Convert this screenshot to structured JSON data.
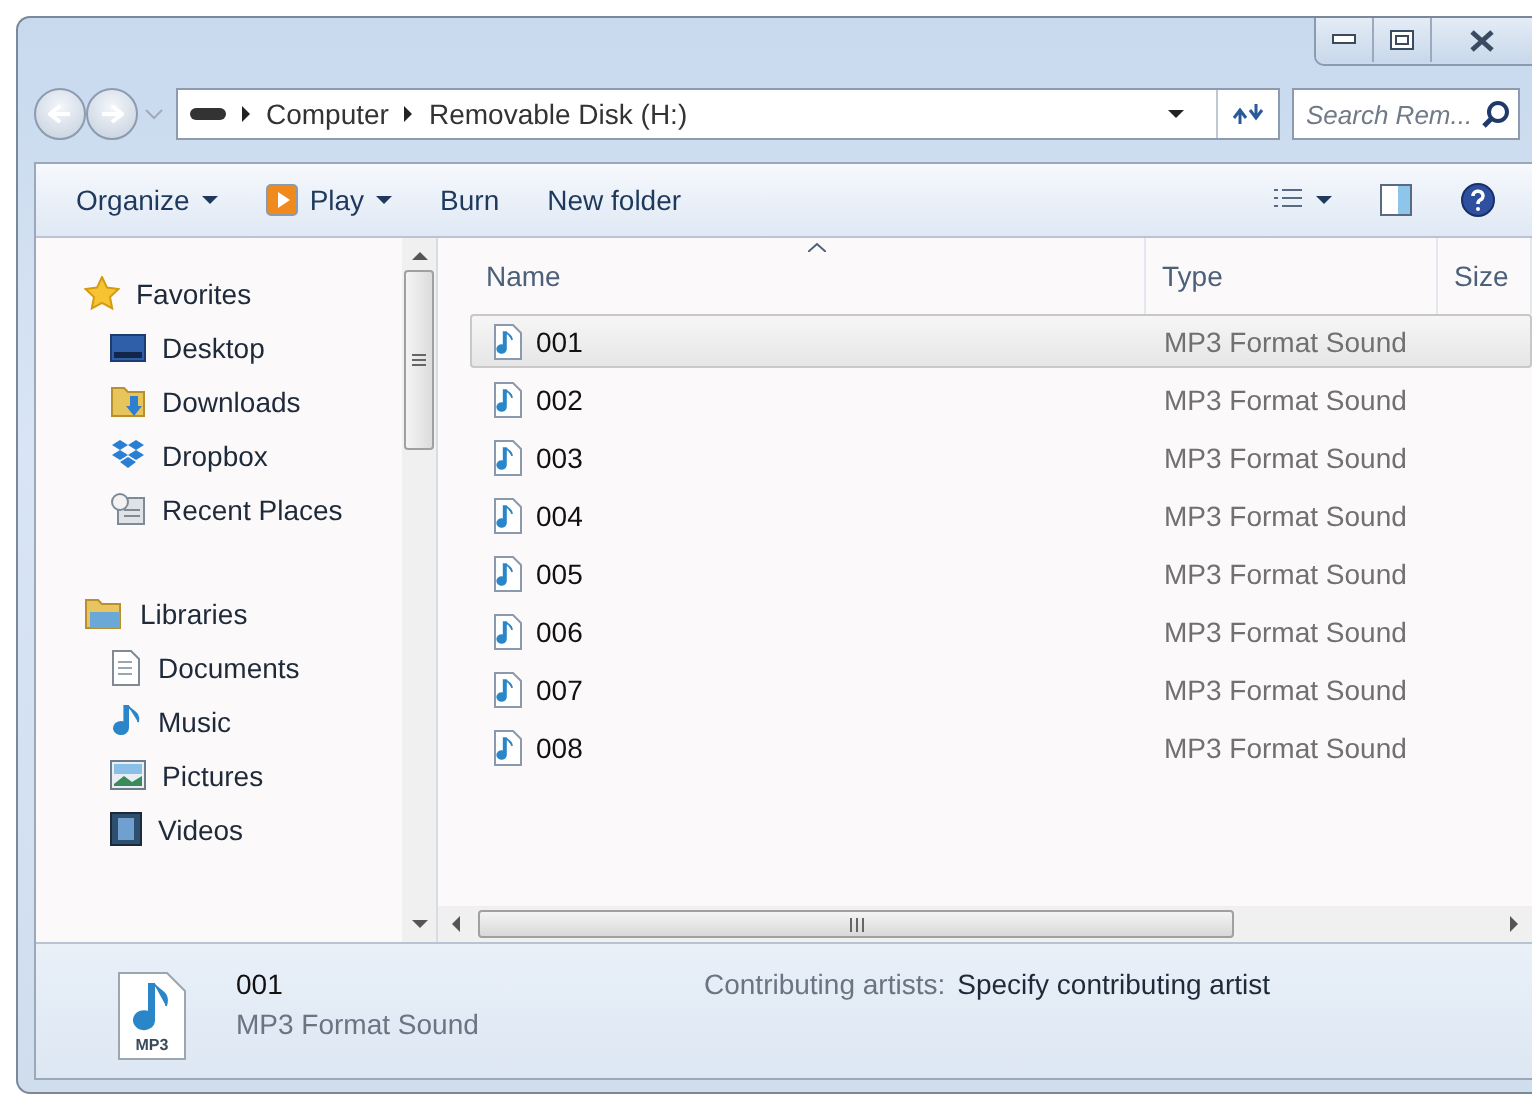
{
  "address_bar": {
    "crumbs": [
      "Computer",
      "Removable Disk (H:)"
    ]
  },
  "search": {
    "placeholder": "Search Rem..."
  },
  "toolbar": {
    "items": [
      {
        "label": "Organize",
        "kind": "menu"
      },
      {
        "label": "Play",
        "kind": "play"
      },
      {
        "label": "Burn",
        "kind": "plain"
      },
      {
        "label": "New folder",
        "kind": "plain"
      }
    ]
  },
  "sidebar": {
    "groups": [
      {
        "label": "Favorites",
        "kind": "star",
        "children": [
          {
            "label": "Desktop",
            "kind": "desktop"
          },
          {
            "label": "Downloads",
            "kind": "downloads"
          },
          {
            "label": "Dropbox",
            "kind": "dropbox"
          },
          {
            "label": "Recent Places",
            "kind": "recent"
          }
        ]
      },
      {
        "label": "Libraries",
        "kind": "libraries",
        "children": [
          {
            "label": "Documents",
            "kind": "documents"
          },
          {
            "label": "Music",
            "kind": "music"
          },
          {
            "label": "Pictures",
            "kind": "pictures"
          },
          {
            "label": "Videos",
            "kind": "videos"
          }
        ]
      }
    ]
  },
  "file_list": {
    "columns": [
      {
        "label": "Name",
        "sorted": true
      },
      {
        "label": "Type",
        "sorted": false
      },
      {
        "label": "Size",
        "sorted": false
      }
    ],
    "rows": [
      {
        "name": "001",
        "type": "MP3 Format Sound",
        "selected": true
      },
      {
        "name": "002",
        "type": "MP3 Format Sound",
        "selected": false
      },
      {
        "name": "003",
        "type": "MP3 Format Sound",
        "selected": false
      },
      {
        "name": "004",
        "type": "MP3 Format Sound",
        "selected": false
      },
      {
        "name": "005",
        "type": "MP3 Format Sound",
        "selected": false
      },
      {
        "name": "006",
        "type": "MP3 Format Sound",
        "selected": false
      },
      {
        "name": "007",
        "type": "MP3 Format Sound",
        "selected": false
      },
      {
        "name": "008",
        "type": "MP3 Format Sound",
        "selected": false
      }
    ]
  },
  "details": {
    "icon_label": "MP3",
    "name": "001",
    "type": "MP3 Format Sound",
    "field_label": "Contributing artists:",
    "field_value": "Specify contributing artist"
  }
}
